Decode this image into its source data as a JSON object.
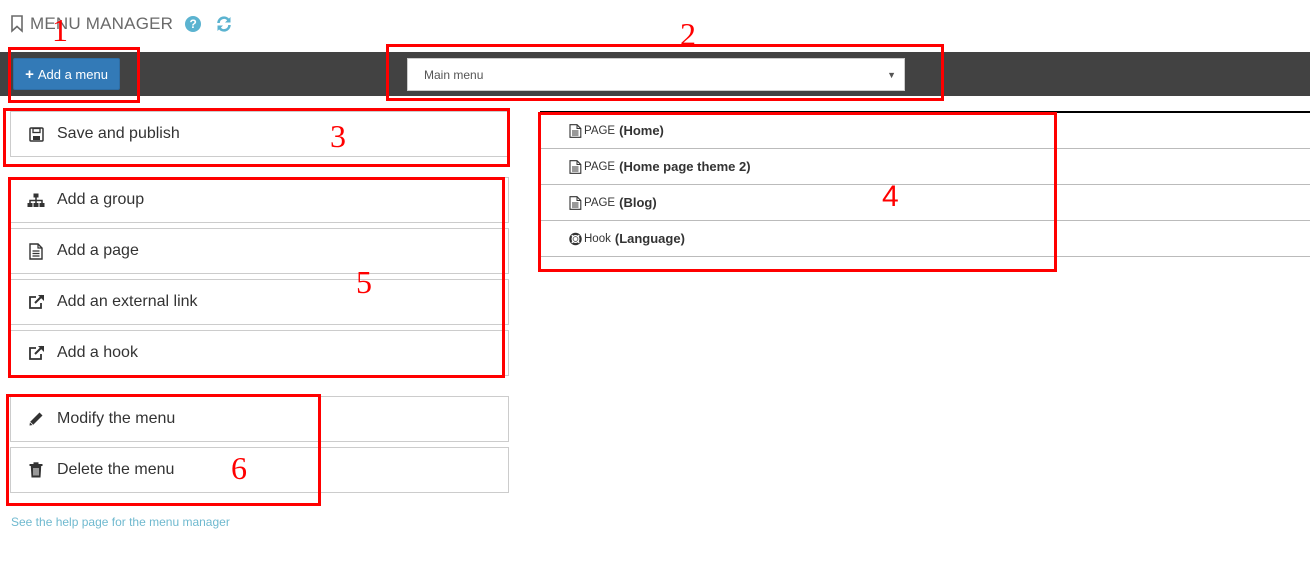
{
  "header": {
    "title": "MENU MANAGER",
    "bookmark_icon": "bookmark-icon",
    "help_icon": "question-circle-icon",
    "help_glyph": "?",
    "refresh_icon": "refresh-icon"
  },
  "toolbar": {
    "add_menu_label": "Add a menu",
    "add_menu_glyph": "+",
    "menu_select": {
      "selected": "Main menu",
      "caret": "▼"
    }
  },
  "actions": {
    "save": {
      "label": "Save and publish",
      "icon": "floppy-disk-icon"
    },
    "add_items": [
      {
        "label": "Add a group",
        "icon": "sitemap-icon"
      },
      {
        "label": "Add a page",
        "icon": "file-text-icon"
      },
      {
        "label": "Add an external link",
        "icon": "external-link-icon"
      },
      {
        "label": "Add a hook",
        "icon": "external-link-icon"
      }
    ],
    "menu_ops": [
      {
        "label": "Modify the menu",
        "icon": "pencil-icon"
      },
      {
        "label": "Delete the menu",
        "icon": "trash-icon"
      }
    ]
  },
  "help_link": "See the help page for the menu manager",
  "menu_tree": [
    {
      "type": "PAGE",
      "label": "(Home)",
      "icon": "file-text-icon"
    },
    {
      "type": "PAGE",
      "label": "(Home page theme 2)",
      "icon": "file-text-icon"
    },
    {
      "type": "PAGE",
      "label": "(Blog)",
      "icon": "file-text-icon"
    },
    {
      "type": "Hook",
      "label": "(Language)",
      "icon": "life-ring-icon"
    }
  ],
  "annotations": [
    "1",
    "2",
    "3",
    "4",
    "5",
    "6"
  ],
  "colors": {
    "primary": "#337ab7",
    "toolbar": "#424242",
    "link": "#6fb9cf",
    "annotation": "#ff0000"
  }
}
